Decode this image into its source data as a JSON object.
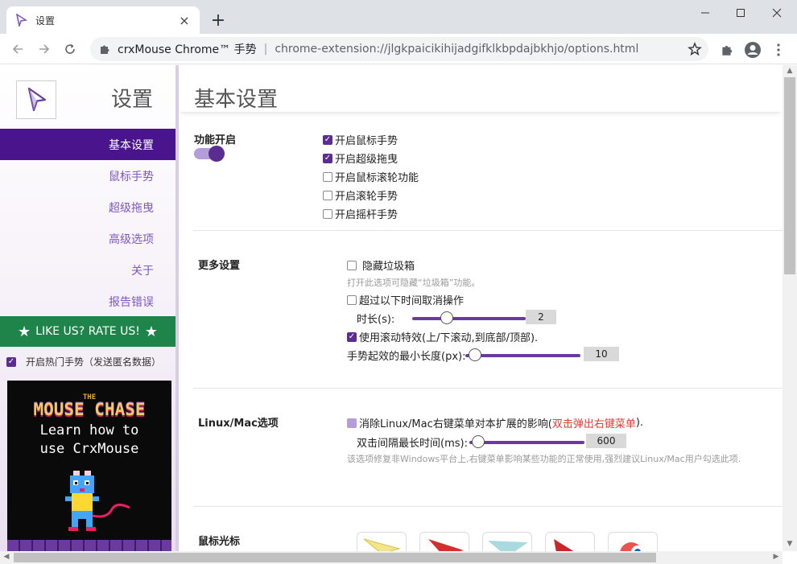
{
  "tab": {
    "title": "设置",
    "close": "×",
    "new_tab": "+"
  },
  "window": {
    "minimize": "—",
    "maximize": "☐",
    "close": "✕"
  },
  "address": {
    "site": "crxMouse Chrome™ 手势",
    "separator": "|",
    "url": "chrome-extension://jlgkpaicikihijadgifklkbpdajbkhjo/options.html"
  },
  "sidebar": {
    "title": "设置",
    "items": [
      {
        "label": "基本设置",
        "active": true
      },
      {
        "label": "鼠标手势"
      },
      {
        "label": "超级拖曳"
      },
      {
        "label": "高级选项"
      },
      {
        "label": "关于"
      },
      {
        "label": "报告错误"
      }
    ],
    "rate_label": "LIKE US? RATE US!",
    "hot_gestures_label": "开启热门手势（发送匿名数据）",
    "promo": {
      "the": "THE",
      "title": "MOUSE CHASE",
      "line1": "Learn how to",
      "line2": "use CrxMouse"
    }
  },
  "page": {
    "title": "基本设置"
  },
  "sections": {
    "features": {
      "label": "功能开启",
      "options": [
        {
          "label": "开启鼠标手势",
          "checked": true
        },
        {
          "label": "开启超级拖曳",
          "checked": true
        },
        {
          "label": "开启鼠标滚轮功能",
          "checked": false
        },
        {
          "label": "开启滚轮手势",
          "checked": false
        },
        {
          "label": "开启摇杆手势",
          "checked": false
        }
      ]
    },
    "more": {
      "label": "更多设置",
      "hide_trash": "隐藏垃圾箱",
      "hide_trash_hint": "打开此选项可隐藏“垃圾箱”功能。",
      "cancel_timeout": "超过以下时间取消操作",
      "duration_label": "时长(s):",
      "duration_value": "2",
      "duration_fraction": 0.3,
      "smooth_scroll": "使用滚动特效(上/下滚动,到底部/顶部).",
      "min_length_label": "手势起效的最小长度(px):",
      "min_length_value": "10",
      "min_length_fraction": 0.08
    },
    "linux": {
      "label": "Linux/Mac选项",
      "option": "消除Linux/Mac右键菜单对本扩展的影响(",
      "option_link": "双击弹出右键菜单",
      "option_end": ").",
      "dblclick_label": "双击间隔最长时间(ms):",
      "dblclick_value": "600",
      "dblclick_fraction": 0.08,
      "hint": "该选项修复非Windows平台上,右键菜单影响某些功能的正常使用,强烈建议Linux/Mac用户勾选此项."
    },
    "cursor": {
      "label": "鼠标光标"
    }
  },
  "colors": {
    "accent": "#5c2d91",
    "nav_active": "#4a148c",
    "rate_green": "#1e8449",
    "link_red": "#e53935"
  }
}
